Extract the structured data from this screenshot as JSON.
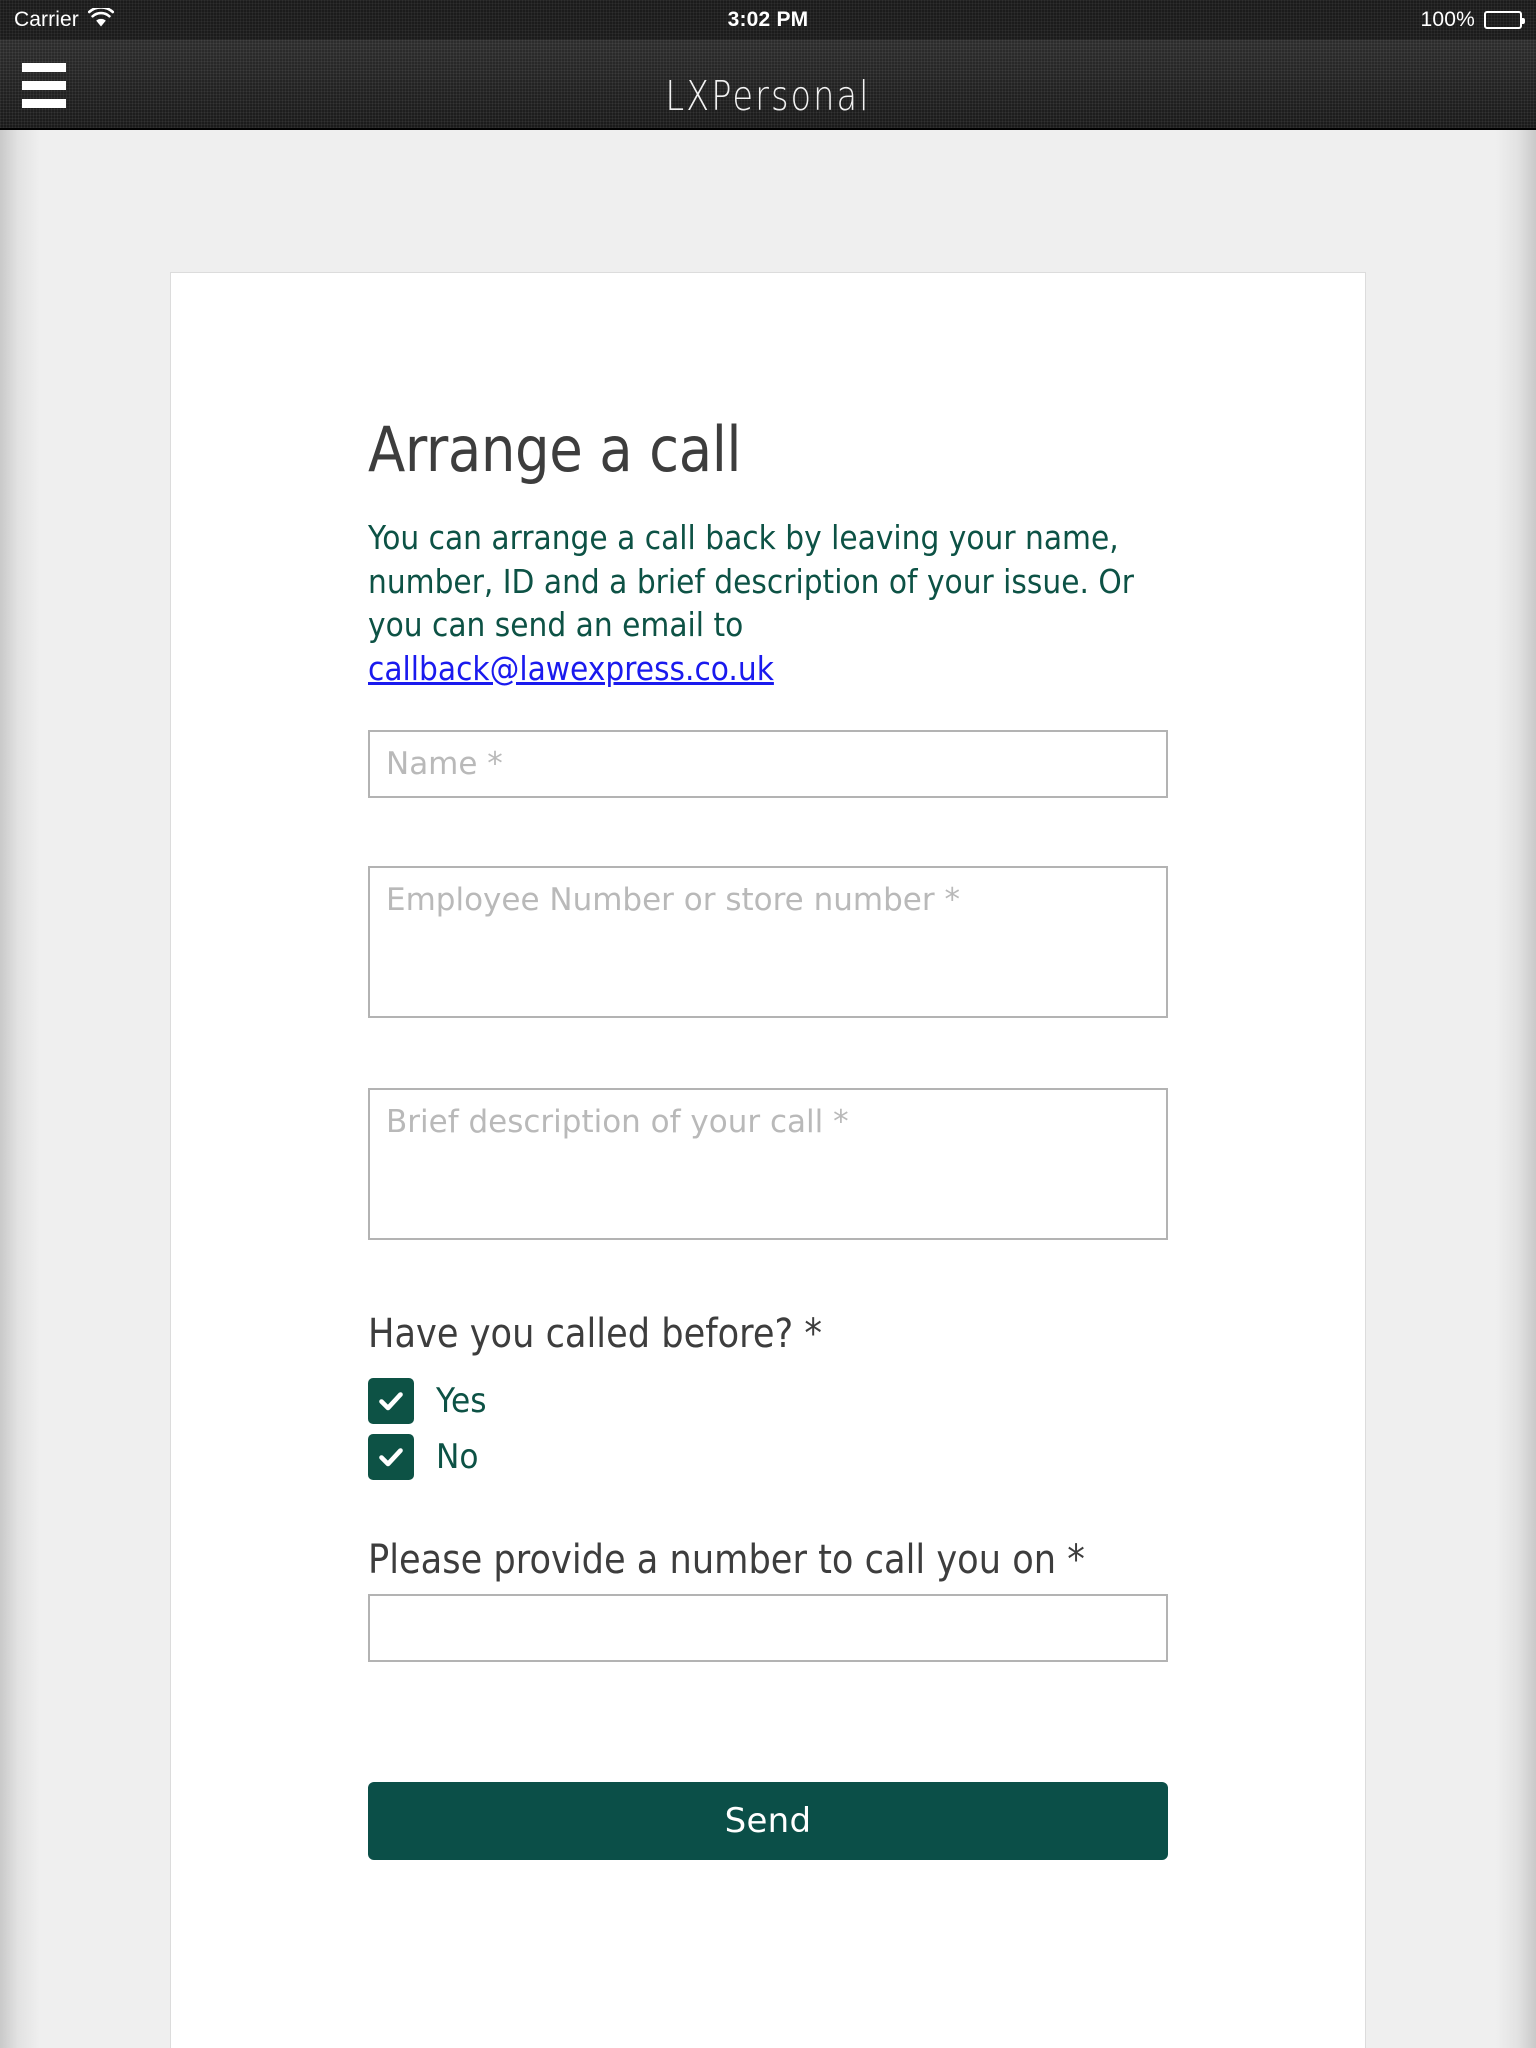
{
  "status_bar": {
    "carrier": "Carrier",
    "wifi_icon": "wifi-icon",
    "time": "3:02 PM",
    "battery_percent": "100%",
    "battery_icon": "battery-icon"
  },
  "nav_bar": {
    "menu_icon": "hamburger-menu-icon",
    "title": "LXPersonal"
  },
  "page": {
    "title": "Arrange a call",
    "intro_text_part1": "You can arrange a call back by leaving your name, number, ID and a brief description of your issue. Or you can send an email to ",
    "email_link": "callback@lawexpress.co.uk"
  },
  "form": {
    "name_field": {
      "placeholder": "Name *",
      "value": ""
    },
    "employee_field": {
      "placeholder": "Employee Number or store number *",
      "value": ""
    },
    "description_field": {
      "placeholder": "Brief description of your call *",
      "value": ""
    },
    "called_before_question": "Have you called before? *",
    "options": [
      {
        "label": "Yes",
        "checked": true
      },
      {
        "label": "No",
        "checked": true
      }
    ],
    "phone_question": "Please provide a number to call you on *",
    "phone_field": {
      "placeholder": "",
      "value": ""
    },
    "submit_label": "Send"
  },
  "colors": {
    "brand_teal": "#0d5245",
    "button_teal": "#0b4f48",
    "link_blue": "#1a1aee",
    "heading_gray": "#3d3d3d",
    "placeholder_gray": "#b9b9b9",
    "page_bg": "#efefef"
  }
}
